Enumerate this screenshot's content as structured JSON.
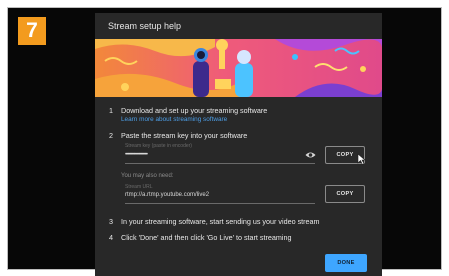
{
  "step_badge": "7",
  "dialog": {
    "title": "Stream setup help",
    "steps": [
      {
        "num": "1",
        "text": "Download and set up your streaming software"
      },
      {
        "num": "2",
        "text": "Paste the stream key into your software"
      },
      {
        "num": "3",
        "text": "In your streaming software, start sending us your video stream"
      },
      {
        "num": "4",
        "text": "Click 'Done' and then click 'Go Live' to start streaming"
      }
    ],
    "software_link": "Learn more about streaming software",
    "stream_key": {
      "hint": "Stream key (paste in encoder)",
      "value": "••••••••••••••••••••",
      "copy_label": "COPY"
    },
    "may_also_need": "You may also need:",
    "stream_url": {
      "hint": "Stream URL",
      "value": "rtmp://a.rtmp.youtube.com/live2",
      "copy_label": "COPY"
    },
    "done_label": "DONE"
  },
  "colors": {
    "badge": "#f39b1e",
    "link": "#4d9fe8",
    "done_button": "#3ea6ff",
    "dialog_bg": "#282828"
  },
  "icons": [
    "eye-icon",
    "cursor-icon"
  ]
}
